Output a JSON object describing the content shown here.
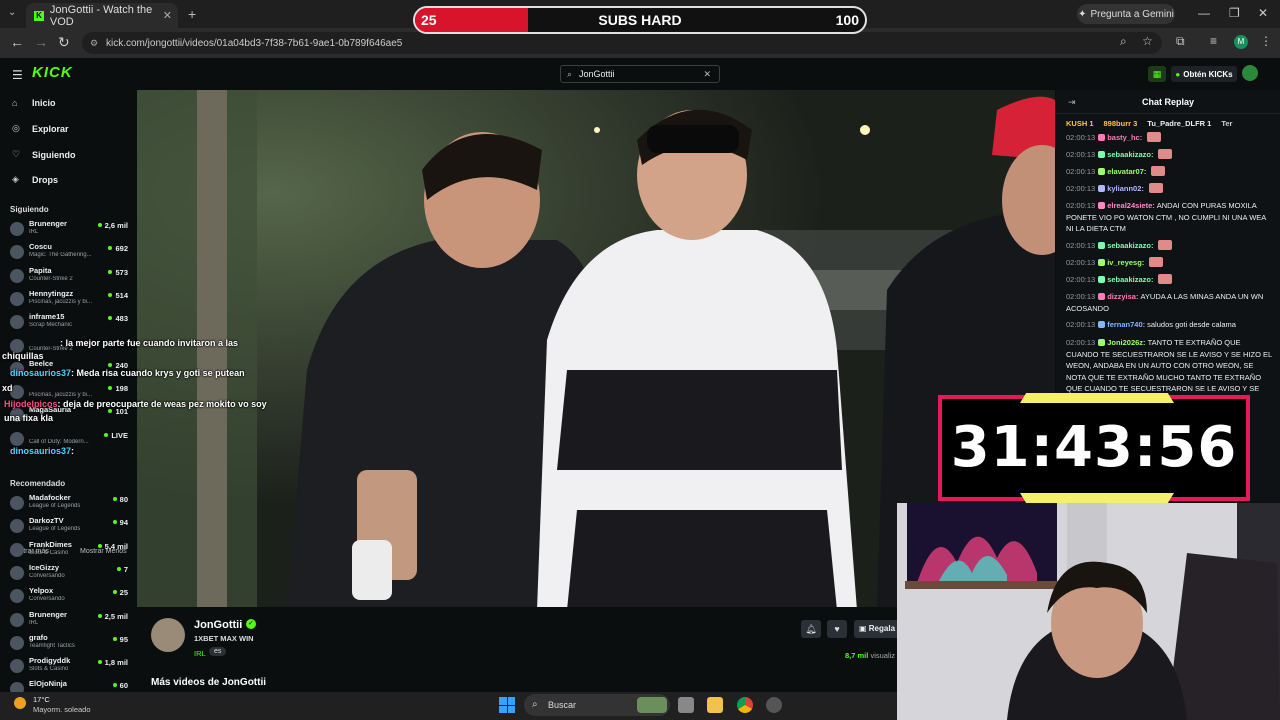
{
  "browser": {
    "tab_title": "JonGottii - Watch the VOD",
    "url": "kick.com/jongottii/videos/01a04bd3-7f38-7b61-9ae1-0b789f646ae5",
    "gemini_label": "Pregunta a Gemini",
    "profile_initial": "M"
  },
  "kick": {
    "logo": "KICK",
    "search_value": "JonGottii",
    "kicks_label": "Obtén KICKs"
  },
  "sidebar": {
    "nav": [
      {
        "label": "Inicio",
        "icon": "home-icon"
      },
      {
        "label": "Explorar",
        "icon": "compass-icon"
      },
      {
        "label": "Siguiendo",
        "icon": "heart-icon"
      },
      {
        "label": "Drops",
        "icon": "drop-icon"
      }
    ],
    "following_header": "Siguiendo",
    "following": [
      {
        "name": "Brunenger",
        "category": "IRL",
        "viewers": "2,6 mil"
      },
      {
        "name": "Coscu",
        "category": "Magic: The Gathering...",
        "viewers": "692"
      },
      {
        "name": "Papita",
        "category": "Counter-Strike 2",
        "viewers": "573"
      },
      {
        "name": "Hennytingzz",
        "category": "Piscinas, jacuzzis y bi...",
        "viewers": "514"
      },
      {
        "name": "inframe15",
        "category": "Scrap Mechanic",
        "viewers": "483"
      },
      {
        "name": "",
        "category": "Counter-Strike 2",
        "viewers": ""
      },
      {
        "name": "Beelce",
        "category": "",
        "viewers": "240"
      },
      {
        "name": "",
        "category": "Piscinas, jacuzzis y bi...",
        "viewers": "198"
      },
      {
        "name": "MagaSauria",
        "category": "",
        "viewers": "101"
      },
      {
        "name": "",
        "category": "Call of Duty: Modern...",
        "viewers": "LIVE"
      }
    ],
    "show_more": "Mostrar más",
    "show_less": "Mostrar Menos",
    "recommended_header": "Recomendado",
    "recommended": [
      {
        "name": "Madafocker",
        "category": "League of Legends",
        "viewers": "80"
      },
      {
        "name": "DarkozTV",
        "category": "League of Legends",
        "viewers": "94"
      },
      {
        "name": "FrankDimes",
        "category": "Slots & Casino",
        "viewers": "5,4 mil"
      },
      {
        "name": "IceGizzy",
        "category": "Conversando",
        "viewers": "7"
      },
      {
        "name": "Yelpox",
        "category": "Conversando",
        "viewers": "25"
      },
      {
        "name": "Brunenger",
        "category": "IRL",
        "viewers": "2,5 mil"
      },
      {
        "name": "grafo",
        "category": "Teamfight Tactics",
        "viewers": "95"
      },
      {
        "name": "Prodigyddk",
        "category": "Slots & Casino",
        "viewers": "1,8 mil"
      },
      {
        "name": "ElOjoNinja",
        "category": "",
        "viewers": "60"
      }
    ]
  },
  "overlay_chat": [
    {
      "user": "",
      "text": ": la mejor parte fue cuando invitaron a las"
    },
    {
      "user": "",
      "text": "chiquillas"
    },
    {
      "user": "dinosaurios37",
      "text": ": Meda risa cuando krys y goti se putean"
    },
    {
      "user": "",
      "text": "xd"
    },
    {
      "user": "Hijodelpicos",
      "text": ": deja de preocuparte de weas pez mokito vo soy"
    },
    {
      "user": "",
      "text": "una fixa kla"
    },
    {
      "user": "dinosaurios37",
      "text": ":"
    }
  ],
  "subs_goal": {
    "current": "25",
    "label": "SUBS HARD",
    "target": "100",
    "progress": 0.25
  },
  "stream_info": {
    "channel": "JonGottii",
    "title": "1XBET MAX WIN",
    "category": "IRL",
    "language": "es",
    "gift_label": "Regala",
    "viewers": "8,7 mil",
    "viewers_suffix": "visualiz",
    "more_videos": "Más videos de JonGottii"
  },
  "chat": {
    "header": "Chat Replay",
    "gifters": [
      "KUSH 1",
      "898burr 3",
      "Tu_Padre_DLFR 1",
      "Ter"
    ],
    "messages": [
      {
        "ts": "02:00:13",
        "user": "basty_hc:",
        "color": "#ff7ab8",
        "text": ""
      },
      {
        "ts": "02:00:13",
        "user": "sebaakizazo:",
        "color": "#7dffb0",
        "text": ""
      },
      {
        "ts": "02:00:13",
        "user": "elavatar07:",
        "color": "#9dff6b",
        "text": ""
      },
      {
        "ts": "02:00:13",
        "user": "kyliann02:",
        "color": "#b0b8ff",
        "text": ""
      },
      {
        "ts": "02:00:13",
        "user": "elreal24siete:",
        "color": "#ff8ac6",
        "text": "ANDAI CON PURAS MOXILA PONETE VIO PO WATON CTM , NO CUMPLI NI UNA WEA NI LA DIETA CTM"
      },
      {
        "ts": "02:00:13",
        "user": "sebaakizazo:",
        "color": "#7dffb0",
        "text": ""
      },
      {
        "ts": "02:00:13",
        "user": "iv_reyesg:",
        "color": "#9dff6b",
        "text": ""
      },
      {
        "ts": "02:00:13",
        "user": "sebaakizazo:",
        "color": "#7dffb0",
        "text": ""
      },
      {
        "ts": "02:00:13",
        "user": "dizzyisa:",
        "color": "#ff7ab8",
        "text": "AYUDA A LAS MINAS ANDA UN WN ACOSANDO"
      },
      {
        "ts": "02:00:13",
        "user": "fernan740:",
        "color": "#7fb8ff",
        "text": "saludos goti desde calama"
      },
      {
        "ts": "02:00:13",
        "user": "Joni2026z:",
        "color": "#9dff6b",
        "text": "TANTO TE EXTRAÑO QUE CUANDO TE SECUESTRARON SE LE AVISO Y SE HIZO EL WEON, ANDABA EN UN AUTO CON OTRO WEON, SE NOTA QUE TE EXTRAÑO MUCHO TANTO TE EXTRAÑO QUE CUANDO TE SECUESTRARON SE LE AVISO Y SE HIZO EL WEON, ANDABA EN UN AUTO CON OTRO WEON, SE NOTA QUE TE EXTRAÑO MUCHO"
      }
    ]
  },
  "timer": {
    "value": "31:43:56"
  },
  "taskbar": {
    "temp": "17°C",
    "weather": "Mayorm. soleado",
    "search": "Buscar"
  }
}
